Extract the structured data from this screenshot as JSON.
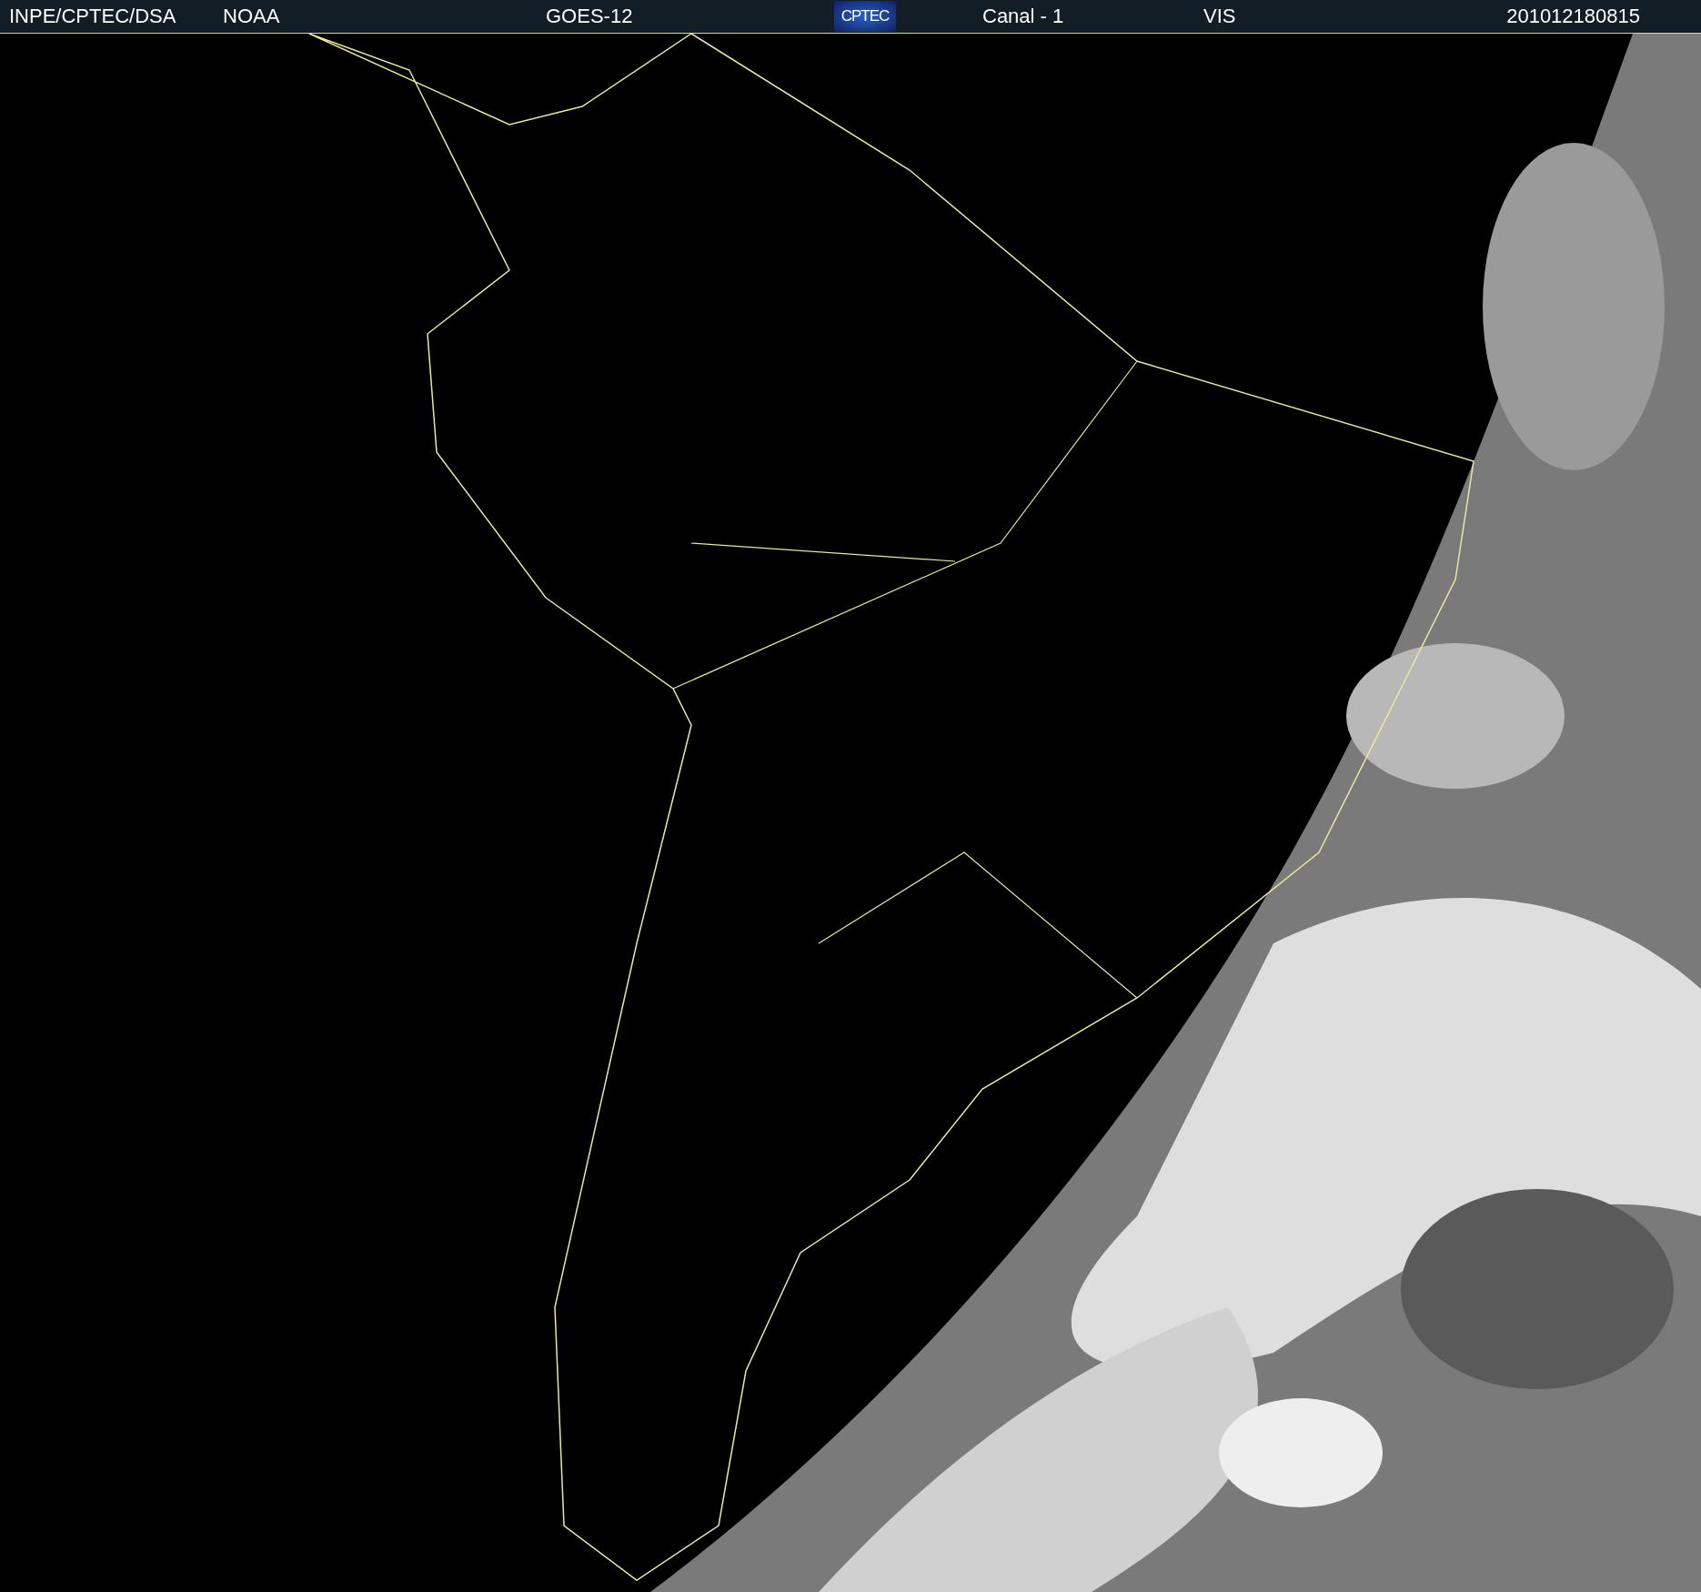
{
  "header": {
    "left_labels": [
      "INPE/CPTEC/DSA",
      "NOAA",
      "GOES-12"
    ],
    "logo_text": "CPTEC",
    "right_labels": [
      "Canal - 1",
      "VIS",
      "201012180815"
    ]
  }
}
